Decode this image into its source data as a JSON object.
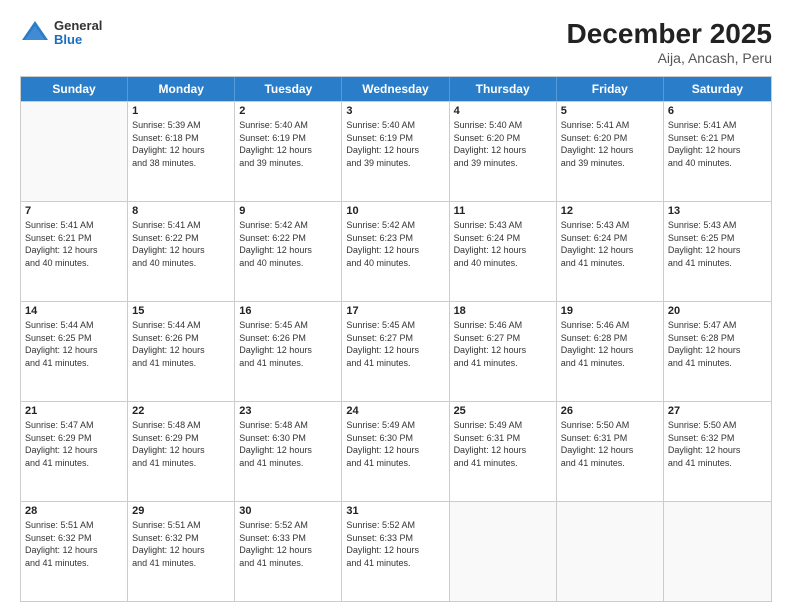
{
  "header": {
    "logo_general": "General",
    "logo_blue": "Blue",
    "main_title": "December 2025",
    "subtitle": "Aija, Ancash, Peru"
  },
  "days_of_week": [
    "Sunday",
    "Monday",
    "Tuesday",
    "Wednesday",
    "Thursday",
    "Friday",
    "Saturday"
  ],
  "weeks": [
    [
      {
        "day": "",
        "info": ""
      },
      {
        "day": "1",
        "info": "Sunrise: 5:39 AM\nSunset: 6:18 PM\nDaylight: 12 hours\nand 38 minutes."
      },
      {
        "day": "2",
        "info": "Sunrise: 5:40 AM\nSunset: 6:19 PM\nDaylight: 12 hours\nand 39 minutes."
      },
      {
        "day": "3",
        "info": "Sunrise: 5:40 AM\nSunset: 6:19 PM\nDaylight: 12 hours\nand 39 minutes."
      },
      {
        "day": "4",
        "info": "Sunrise: 5:40 AM\nSunset: 6:20 PM\nDaylight: 12 hours\nand 39 minutes."
      },
      {
        "day": "5",
        "info": "Sunrise: 5:41 AM\nSunset: 6:20 PM\nDaylight: 12 hours\nand 39 minutes."
      },
      {
        "day": "6",
        "info": "Sunrise: 5:41 AM\nSunset: 6:21 PM\nDaylight: 12 hours\nand 40 minutes."
      }
    ],
    [
      {
        "day": "7",
        "info": "Sunrise: 5:41 AM\nSunset: 6:21 PM\nDaylight: 12 hours\nand 40 minutes."
      },
      {
        "day": "8",
        "info": "Sunrise: 5:41 AM\nSunset: 6:22 PM\nDaylight: 12 hours\nand 40 minutes."
      },
      {
        "day": "9",
        "info": "Sunrise: 5:42 AM\nSunset: 6:22 PM\nDaylight: 12 hours\nand 40 minutes."
      },
      {
        "day": "10",
        "info": "Sunrise: 5:42 AM\nSunset: 6:23 PM\nDaylight: 12 hours\nand 40 minutes."
      },
      {
        "day": "11",
        "info": "Sunrise: 5:43 AM\nSunset: 6:24 PM\nDaylight: 12 hours\nand 40 minutes."
      },
      {
        "day": "12",
        "info": "Sunrise: 5:43 AM\nSunset: 6:24 PM\nDaylight: 12 hours\nand 41 minutes."
      },
      {
        "day": "13",
        "info": "Sunrise: 5:43 AM\nSunset: 6:25 PM\nDaylight: 12 hours\nand 41 minutes."
      }
    ],
    [
      {
        "day": "14",
        "info": "Sunrise: 5:44 AM\nSunset: 6:25 PM\nDaylight: 12 hours\nand 41 minutes."
      },
      {
        "day": "15",
        "info": "Sunrise: 5:44 AM\nSunset: 6:26 PM\nDaylight: 12 hours\nand 41 minutes."
      },
      {
        "day": "16",
        "info": "Sunrise: 5:45 AM\nSunset: 6:26 PM\nDaylight: 12 hours\nand 41 minutes."
      },
      {
        "day": "17",
        "info": "Sunrise: 5:45 AM\nSunset: 6:27 PM\nDaylight: 12 hours\nand 41 minutes."
      },
      {
        "day": "18",
        "info": "Sunrise: 5:46 AM\nSunset: 6:27 PM\nDaylight: 12 hours\nand 41 minutes."
      },
      {
        "day": "19",
        "info": "Sunrise: 5:46 AM\nSunset: 6:28 PM\nDaylight: 12 hours\nand 41 minutes."
      },
      {
        "day": "20",
        "info": "Sunrise: 5:47 AM\nSunset: 6:28 PM\nDaylight: 12 hours\nand 41 minutes."
      }
    ],
    [
      {
        "day": "21",
        "info": "Sunrise: 5:47 AM\nSunset: 6:29 PM\nDaylight: 12 hours\nand 41 minutes."
      },
      {
        "day": "22",
        "info": "Sunrise: 5:48 AM\nSunset: 6:29 PM\nDaylight: 12 hours\nand 41 minutes."
      },
      {
        "day": "23",
        "info": "Sunrise: 5:48 AM\nSunset: 6:30 PM\nDaylight: 12 hours\nand 41 minutes."
      },
      {
        "day": "24",
        "info": "Sunrise: 5:49 AM\nSunset: 6:30 PM\nDaylight: 12 hours\nand 41 minutes."
      },
      {
        "day": "25",
        "info": "Sunrise: 5:49 AM\nSunset: 6:31 PM\nDaylight: 12 hours\nand 41 minutes."
      },
      {
        "day": "26",
        "info": "Sunrise: 5:50 AM\nSunset: 6:31 PM\nDaylight: 12 hours\nand 41 minutes."
      },
      {
        "day": "27",
        "info": "Sunrise: 5:50 AM\nSunset: 6:32 PM\nDaylight: 12 hours\nand 41 minutes."
      }
    ],
    [
      {
        "day": "28",
        "info": "Sunrise: 5:51 AM\nSunset: 6:32 PM\nDaylight: 12 hours\nand 41 minutes."
      },
      {
        "day": "29",
        "info": "Sunrise: 5:51 AM\nSunset: 6:32 PM\nDaylight: 12 hours\nand 41 minutes."
      },
      {
        "day": "30",
        "info": "Sunrise: 5:52 AM\nSunset: 6:33 PM\nDaylight: 12 hours\nand 41 minutes."
      },
      {
        "day": "31",
        "info": "Sunrise: 5:52 AM\nSunset: 6:33 PM\nDaylight: 12 hours\nand 41 minutes."
      },
      {
        "day": "",
        "info": ""
      },
      {
        "day": "",
        "info": ""
      },
      {
        "day": "",
        "info": ""
      }
    ]
  ]
}
